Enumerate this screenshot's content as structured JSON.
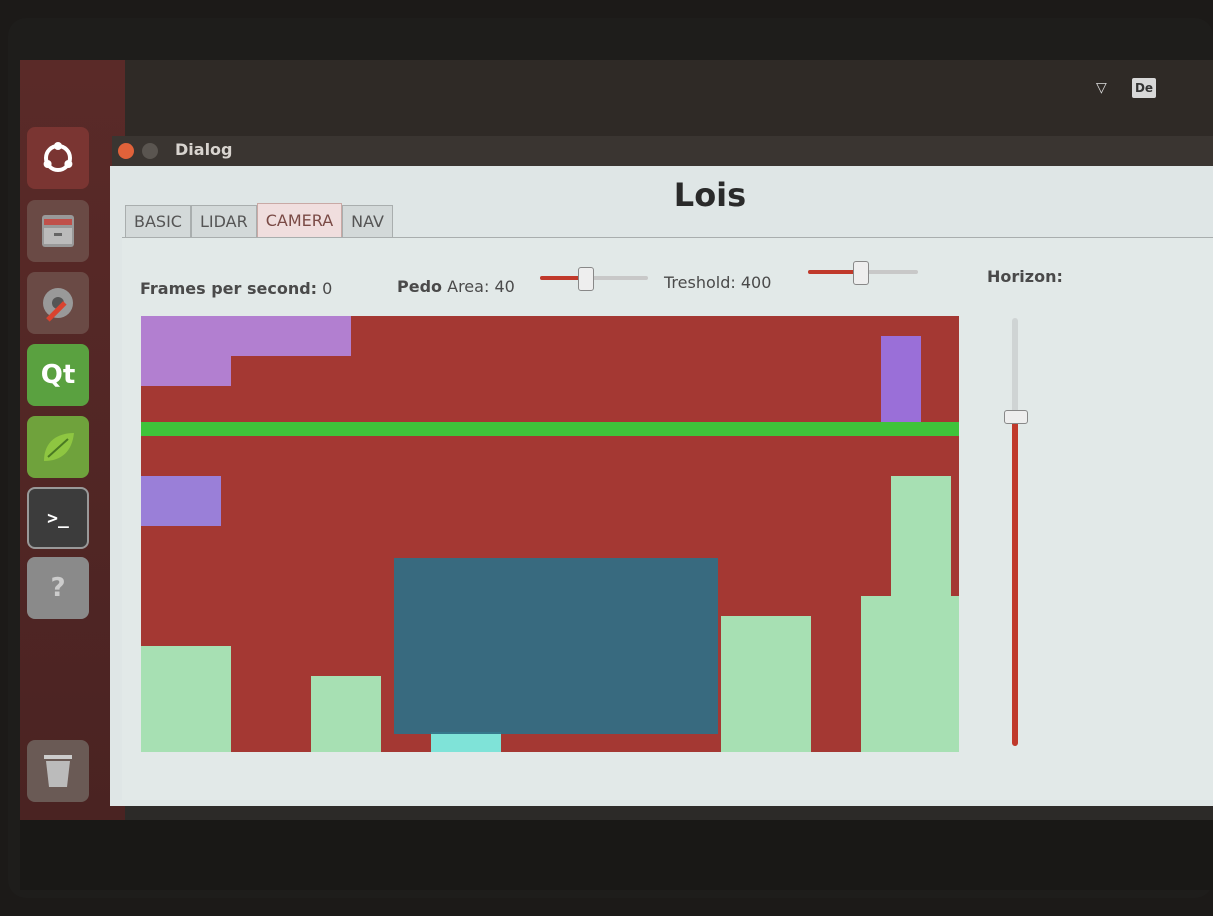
{
  "top_panel": {
    "keyboard_indicator": "De",
    "wifi_icon": "wifi-icon"
  },
  "launcher": {
    "items": [
      {
        "name": "ubuntu-dash",
        "icon": "ubuntu-logo-icon"
      },
      {
        "name": "files",
        "icon": "file-cabinet-icon"
      },
      {
        "name": "system-settings",
        "icon": "settings-wrench-icon"
      },
      {
        "name": "qt-creator",
        "icon": "qt-logo-icon",
        "label": "Qt"
      },
      {
        "name": "mint-app",
        "icon": "leaf-icon"
      },
      {
        "name": "terminal",
        "icon": "terminal-icon",
        "label": ">_"
      },
      {
        "name": "help",
        "icon": "help-icon",
        "label": "?"
      },
      {
        "name": "trash",
        "icon": "trash-icon"
      }
    ]
  },
  "window": {
    "title": "Dialog",
    "heading": "Lois",
    "tabs": [
      {
        "label": "BASIC",
        "active": false
      },
      {
        "label": "LIDAR",
        "active": false
      },
      {
        "label": "CAMERA",
        "active": true
      },
      {
        "label": "NAV",
        "active": false
      }
    ]
  },
  "camera_tab": {
    "fps_label": "Frames per second:",
    "fps_value": "0",
    "pedo_label_bold": "Pedo",
    "pedo_label": "Area:",
    "pedo_value": "40",
    "pedo_slider_fraction": 0.42,
    "threshold_label": "Treshold:",
    "threshold_value": "400",
    "threshold_slider_fraction": 0.47,
    "horizon_label": "Horizon:",
    "horizon_slider_fraction": 0.77,
    "colors": {
      "frame_bg": "#a43833",
      "horizon_line": "#3fc33a",
      "pedestrian_box": "#2f6f86",
      "purple_regions": "#b27fd0",
      "green_regions": "#a7e0b3",
      "slider_fill": "#c0392b"
    }
  }
}
